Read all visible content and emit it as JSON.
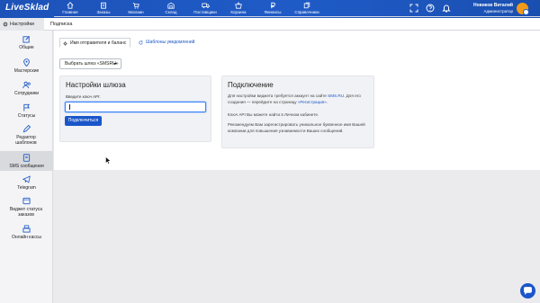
{
  "app": {
    "logo": "LiveSklad"
  },
  "topnav": [
    {
      "key": "home",
      "label": "Главная",
      "icon": "home-icon"
    },
    {
      "key": "orders",
      "label": "Заказы",
      "icon": "clipboard-icon"
    },
    {
      "key": "shop",
      "label": "Магазин",
      "icon": "cart-icon"
    },
    {
      "key": "warehouse",
      "label": "Склад",
      "icon": "warehouse-icon"
    },
    {
      "key": "suppliers",
      "label": "Поставщики",
      "icon": "truck-icon"
    },
    {
      "key": "cart",
      "label": "Корзина",
      "icon": "basket-icon"
    },
    {
      "key": "finance",
      "label": "Финансы",
      "icon": "ruble-icon"
    },
    {
      "key": "directories",
      "label": "Справочники",
      "icon": "books-icon"
    }
  ],
  "user": {
    "name": "Новиков Виталий",
    "role": "Администратор"
  },
  "subtabs": [
    {
      "label": "Настройки",
      "icon": "gear-icon",
      "active": true
    },
    {
      "label": "Подписка",
      "icon": "",
      "active": false
    }
  ],
  "sidebar": [
    {
      "label": "Общие",
      "icon": "edit-icon"
    },
    {
      "label": "Мастерские",
      "icon": "location-pin-icon"
    },
    {
      "label": "Сотрудники",
      "icon": "users-icon"
    },
    {
      "label": "Статусы",
      "icon": "flag-icon"
    },
    {
      "label": "Редактор шаблонов",
      "icon": "pencil-icon"
    },
    {
      "label": "SMS сообщения",
      "icon": "sms-icon",
      "active": true
    },
    {
      "label": "Telegram",
      "icon": "telegram-icon"
    },
    {
      "label": "Виджет статуса заказов",
      "icon": "widget-icon"
    },
    {
      "label": "Онлайн кассы",
      "icon": "cash-register-icon"
    }
  ],
  "page_tabs": [
    {
      "label": "Имя отправителя и баланс",
      "icon": "settings-icon",
      "active": true
    },
    {
      "label": "Шаблоны уведомлений",
      "icon": "refresh-icon",
      "active": false
    }
  ],
  "provider_select": {
    "value": "Выбрать шлюз «SMSRU»"
  },
  "gateway_card": {
    "title": "Настройки шлюза",
    "api_key_label": "Введите ключ API:",
    "api_key_value": "",
    "connect_button": "Подключиться"
  },
  "info_card": {
    "title": "Подключение",
    "p1_before": "Для настройки виджета требуется аккаунт на сайте ",
    "p1_link1": "SMS.RU",
    "p1_middle": ". Для его создания — перейдите на страницу ",
    "p1_link2": "«Регистрация»",
    "p1_after": ".",
    "p2": "Ключ API Вы можете найти в Личном кабинете.",
    "p3": "Рекомендуем Вам зарегистрировать уникальное буквенное имя Вашей компании для повышения узнаваемости Ваших сообщений."
  },
  "colors": {
    "brand_blue": "#1f5bc7",
    "link_blue": "#1a56c9",
    "avatar_orange": "#f29a1a"
  }
}
